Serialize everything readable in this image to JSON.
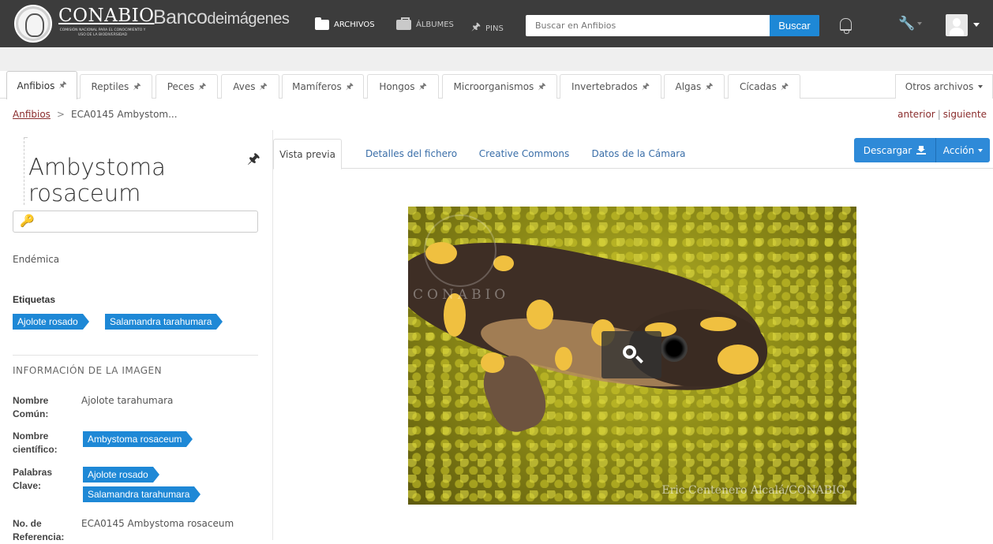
{
  "topbar": {
    "brand": "CONABIO",
    "brand_sub": "COMISIÓN NACIONAL PARA EL CONOCIMIENTO Y USO DE LA BIODIVERSIDAD",
    "banco": "Banco",
    "banco_de": "de",
    "imagenes": "imágenes",
    "nav": [
      {
        "label": "ARCHIVOS",
        "icon": "folder-icon"
      },
      {
        "label": "ÁLBUMES",
        "icon": "briefcase-icon"
      },
      {
        "label": "PINS",
        "icon": "pin-icon"
      }
    ],
    "search_placeholder": "Buscar en Anfibios",
    "search_button": "Buscar"
  },
  "category_tabs": [
    {
      "label": "Anfibios",
      "active": true
    },
    {
      "label": "Reptiles"
    },
    {
      "label": "Peces"
    },
    {
      "label": "Aves"
    },
    {
      "label": "Mamíferos"
    },
    {
      "label": "Hongos"
    },
    {
      "label": "Microorganismos"
    },
    {
      "label": "Invertebrados"
    },
    {
      "label": "Algas"
    },
    {
      "label": "Cícadas"
    }
  ],
  "otros": "Otros archivos",
  "breadcrumb": {
    "root": "Anfibios",
    "separator": ">",
    "current": "ECA0145 Ambystom..."
  },
  "prevnext": {
    "prev": "anterior",
    "sep": "|",
    "next": "siguiente"
  },
  "species": {
    "title": "Ambystoma rosaceum",
    "status": "Endémica",
    "tags_heading": "Etiquetas",
    "tags": [
      "Ajolote rosado",
      "Salamandra tarahumara"
    ]
  },
  "info": {
    "heading": "INFORMACIÓN DE LA IMAGEN",
    "common_name_label": "Nombre Común:",
    "common_name": "Ajolote tarahumara",
    "sci_name_label": "Nombre científico:",
    "sci_name": "Ambystoma rosaceum",
    "keywords_label": "Palabras Clave:",
    "keywords": [
      "Ajolote rosado",
      "Salamandra tarahumara"
    ],
    "ref_label": "No. de Referencia:",
    "ref": "ECA0145 Ambystoma rosaceum"
  },
  "preview_tabs": [
    "Vista previa",
    "Detalles del fichero",
    "Creative Commons",
    "Datos de la Cámara"
  ],
  "buttons": {
    "download": "Descargar",
    "action": "Acción"
  },
  "image": {
    "watermark": "CONABIO",
    "credit": "Eric Centenero Alcalá/CONABIO"
  },
  "colors": {
    "accent": "#1e88d6",
    "topbar": "#3c3c3c",
    "link": "#8a2c2c"
  }
}
